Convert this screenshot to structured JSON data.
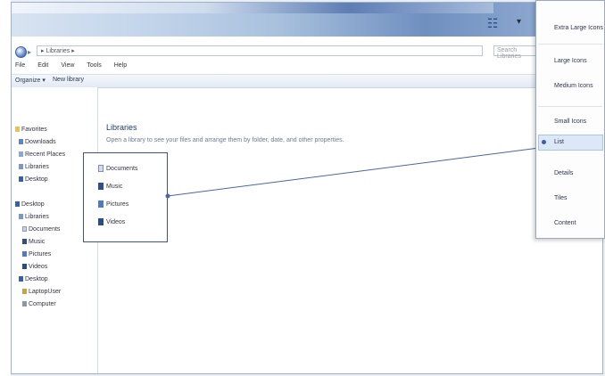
{
  "window": {
    "address_text": "▸ Libraries ▸",
    "search_placeholder": "Search Libraries",
    "view_icon": "view-grid-icon"
  },
  "menubar": [
    "File",
    "Edit",
    "View",
    "Tools",
    "Help"
  ],
  "commandbar": {
    "organize": "Organize ▾",
    "new_library": "New library"
  },
  "navpane": {
    "favorites": [
      "Favorites",
      "Downloads",
      "Recent Places",
      "Libraries",
      "Desktop"
    ],
    "desktop_tree": [
      "Desktop",
      "Libraries",
      "Documents",
      "Music",
      "Pictures",
      "Videos",
      "Desktop",
      "LaptopUser",
      "Computer"
    ]
  },
  "content": {
    "title": "Libraries",
    "subtitle": "Open a library to see your files and arrange them by folder, date, and other properties.",
    "libraries": [
      "Documents",
      "Music",
      "Pictures",
      "Videos"
    ]
  },
  "view_menu": {
    "items": [
      "Extra Large Icons",
      "Large Icons",
      "Medium Icons",
      "Small Icons",
      "List",
      "Details",
      "Tiles",
      "Content"
    ],
    "selected": "List"
  }
}
